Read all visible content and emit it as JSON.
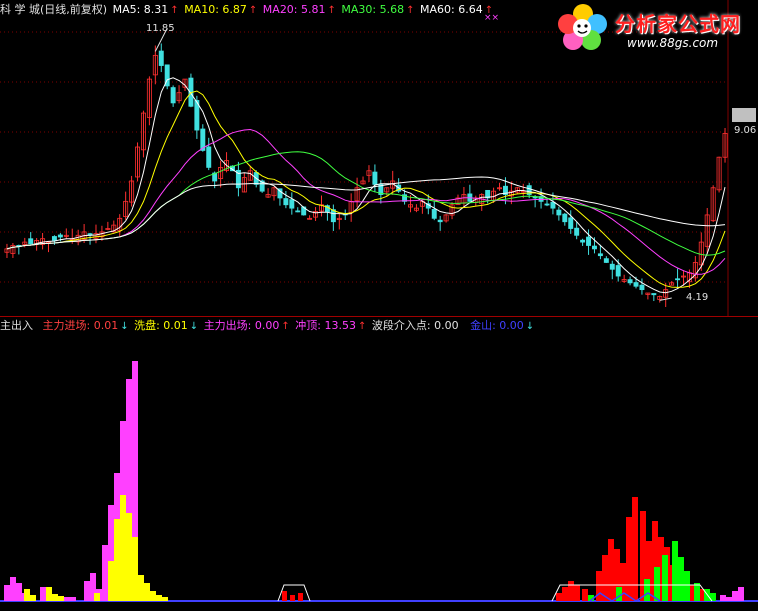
{
  "main_header": {
    "title": "科 学 城(日线,前复权)",
    "ma5_label": "MA5: 8.31",
    "ma5_arrow": "↑",
    "ma10_label": "MA10: 6.87",
    "ma10_arrow": "↑",
    "ma20_label": "MA20: 5.81",
    "ma20_arrow": "↑",
    "ma30_label": "MA30: 5.68",
    "ma30_arrow": "↑",
    "ma60_label": "MA60: 6.64",
    "ma60_arrow": "↑",
    "marker": "××"
  },
  "sub_header": {
    "title": "主出入",
    "zljc_label": "主力进场: 0.01",
    "zljc_arrow": "↓",
    "xp_label": "洗盘: 0.01",
    "xp_arrow": "↓",
    "zlcc_label": "主力出场: 0.00",
    "zlcc_arrow": "↑",
    "cd_label": "冲顶: 13.53",
    "cd_arrow": "↑",
    "bd_label": "波段介入点: 0.00",
    "js_label": "金山: 0.00",
    "js_arrow": "↓"
  },
  "annotations": {
    "high": "11.85",
    "low": "4.19",
    "last": "9.06"
  },
  "logo": {
    "title": "分析家公式网",
    "url": "www.88gs.com"
  },
  "colors": {
    "background": "#000000",
    "up": "#ff3030",
    "down": "#40e0e0",
    "ma5": "#ffffff",
    "ma10": "#ffff00",
    "ma20": "#ff40ff",
    "ma30": "#40ff40",
    "ma60": "#ffffff",
    "zljc": "#ff40ff",
    "xp": "#ffff00",
    "cd": "#ff0000",
    "green": "#00ff00",
    "js": "#4040ff"
  },
  "chart_data": [
    {
      "type": "candlestick",
      "title": "科 学 城(日线,前复权)",
      "series": [
        {
          "name": "MA5",
          "last": 8.31
        },
        {
          "name": "MA10",
          "last": 6.87
        },
        {
          "name": "MA20",
          "last": 5.81
        },
        {
          "name": "MA30",
          "last": 5.68
        },
        {
          "name": "MA60",
          "last": 6.64
        }
      ],
      "ylim": [
        3.8,
        12.4
      ],
      "annotations": [
        11.85,
        4.19,
        9.06
      ],
      "closes": [
        5.6,
        5.7,
        5.7,
        5.8,
        5.75,
        5.85,
        5.9,
        5.8,
        5.85,
        5.95,
        6.0,
        5.9,
        6.0,
        6.1,
        6.0,
        6.05,
        6.1,
        6.2,
        6.3,
        6.5,
        7.0,
        7.6,
        8.6,
        9.6,
        10.6,
        11.3,
        11.0,
        10.4,
        9.9,
        10.2,
        10.6,
        9.8,
        9.1,
        8.5,
        8.0,
        7.6,
        8.0,
        8.2,
        7.9,
        7.4,
        7.7,
        7.9,
        7.5,
        7.3,
        7.2,
        7.4,
        7.1,
        6.9,
        6.8,
        6.7,
        6.6,
        6.5,
        6.7,
        6.9,
        6.7,
        6.4,
        6.5,
        6.6,
        7.0,
        7.4,
        7.6,
        7.9,
        7.5,
        7.2,
        7.4,
        7.6,
        7.3,
        7.0,
        6.9,
        6.8,
        7.0,
        6.8,
        6.5,
        6.4,
        6.6,
        6.9,
        7.1,
        7.2,
        7.0,
        7.1,
        7.2,
        7.1,
        7.3,
        7.4,
        7.2,
        7.3,
        7.4,
        7.3,
        7.2,
        7.1,
        7.0,
        6.9,
        6.8,
        6.6,
        6.4,
        6.2,
        6.0,
        5.8,
        5.7,
        5.6,
        5.4,
        5.2,
        5.0,
        4.8,
        4.7,
        4.6,
        4.5,
        4.4,
        4.3,
        4.25,
        4.2,
        4.4,
        4.6,
        4.7,
        4.8,
        4.9,
        5.2,
        5.8,
        6.6,
        7.4,
        8.3,
        9.0
      ]
    },
    {
      "type": "bar",
      "title": "主出入",
      "series": [
        {
          "name": "主力进场",
          "last": 0.01
        },
        {
          "name": "洗盘",
          "last": 0.01
        },
        {
          "name": "主力出场",
          "last": 0.0
        },
        {
          "name": "冲顶",
          "last": 13.53
        },
        {
          "name": "波段介入点",
          "last": 0.0
        },
        {
          "name": "金山",
          "last": 0.0
        }
      ],
      "ylim": [
        0,
        100
      ]
    }
  ]
}
